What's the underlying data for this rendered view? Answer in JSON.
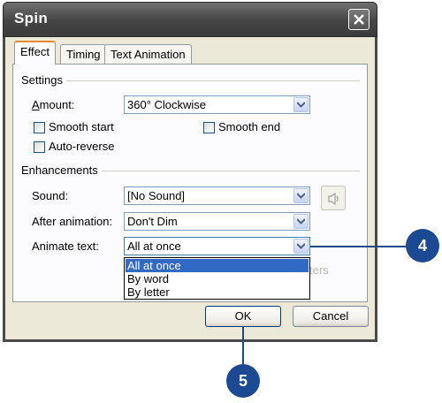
{
  "window": {
    "title": "Spin"
  },
  "tabs": [
    {
      "label": "Effect"
    },
    {
      "label": "Timing"
    },
    {
      "label": "Text Animation"
    }
  ],
  "settings": {
    "group_label": "Settings",
    "amount_label": "Amount:",
    "amount_value": "360° Clockwise",
    "smooth_start": "Smooth start",
    "smooth_end": "Smooth end",
    "auto_reverse": "Auto-reverse"
  },
  "enhancements": {
    "group_label": "Enhancements",
    "sound_label": "Sound:",
    "sound_value": "[No Sound]",
    "after_label": "After animation:",
    "after_value": "Don't Dim",
    "animate_label": "Animate text:",
    "animate_value": "All at once",
    "animate_options": [
      "All at once",
      "By word",
      "By letter"
    ],
    "hidden_suffix": "ters"
  },
  "buttons": {
    "ok": "OK",
    "cancel": "Cancel"
  },
  "callouts": {
    "four": "4",
    "five": "5"
  },
  "colors": {
    "callout": "#1b4a92",
    "selection": "#316ac5",
    "title_bar": "#4a4a4a"
  },
  "icons": [
    "close-icon",
    "chevron-down-icon",
    "speaker-icon"
  ]
}
